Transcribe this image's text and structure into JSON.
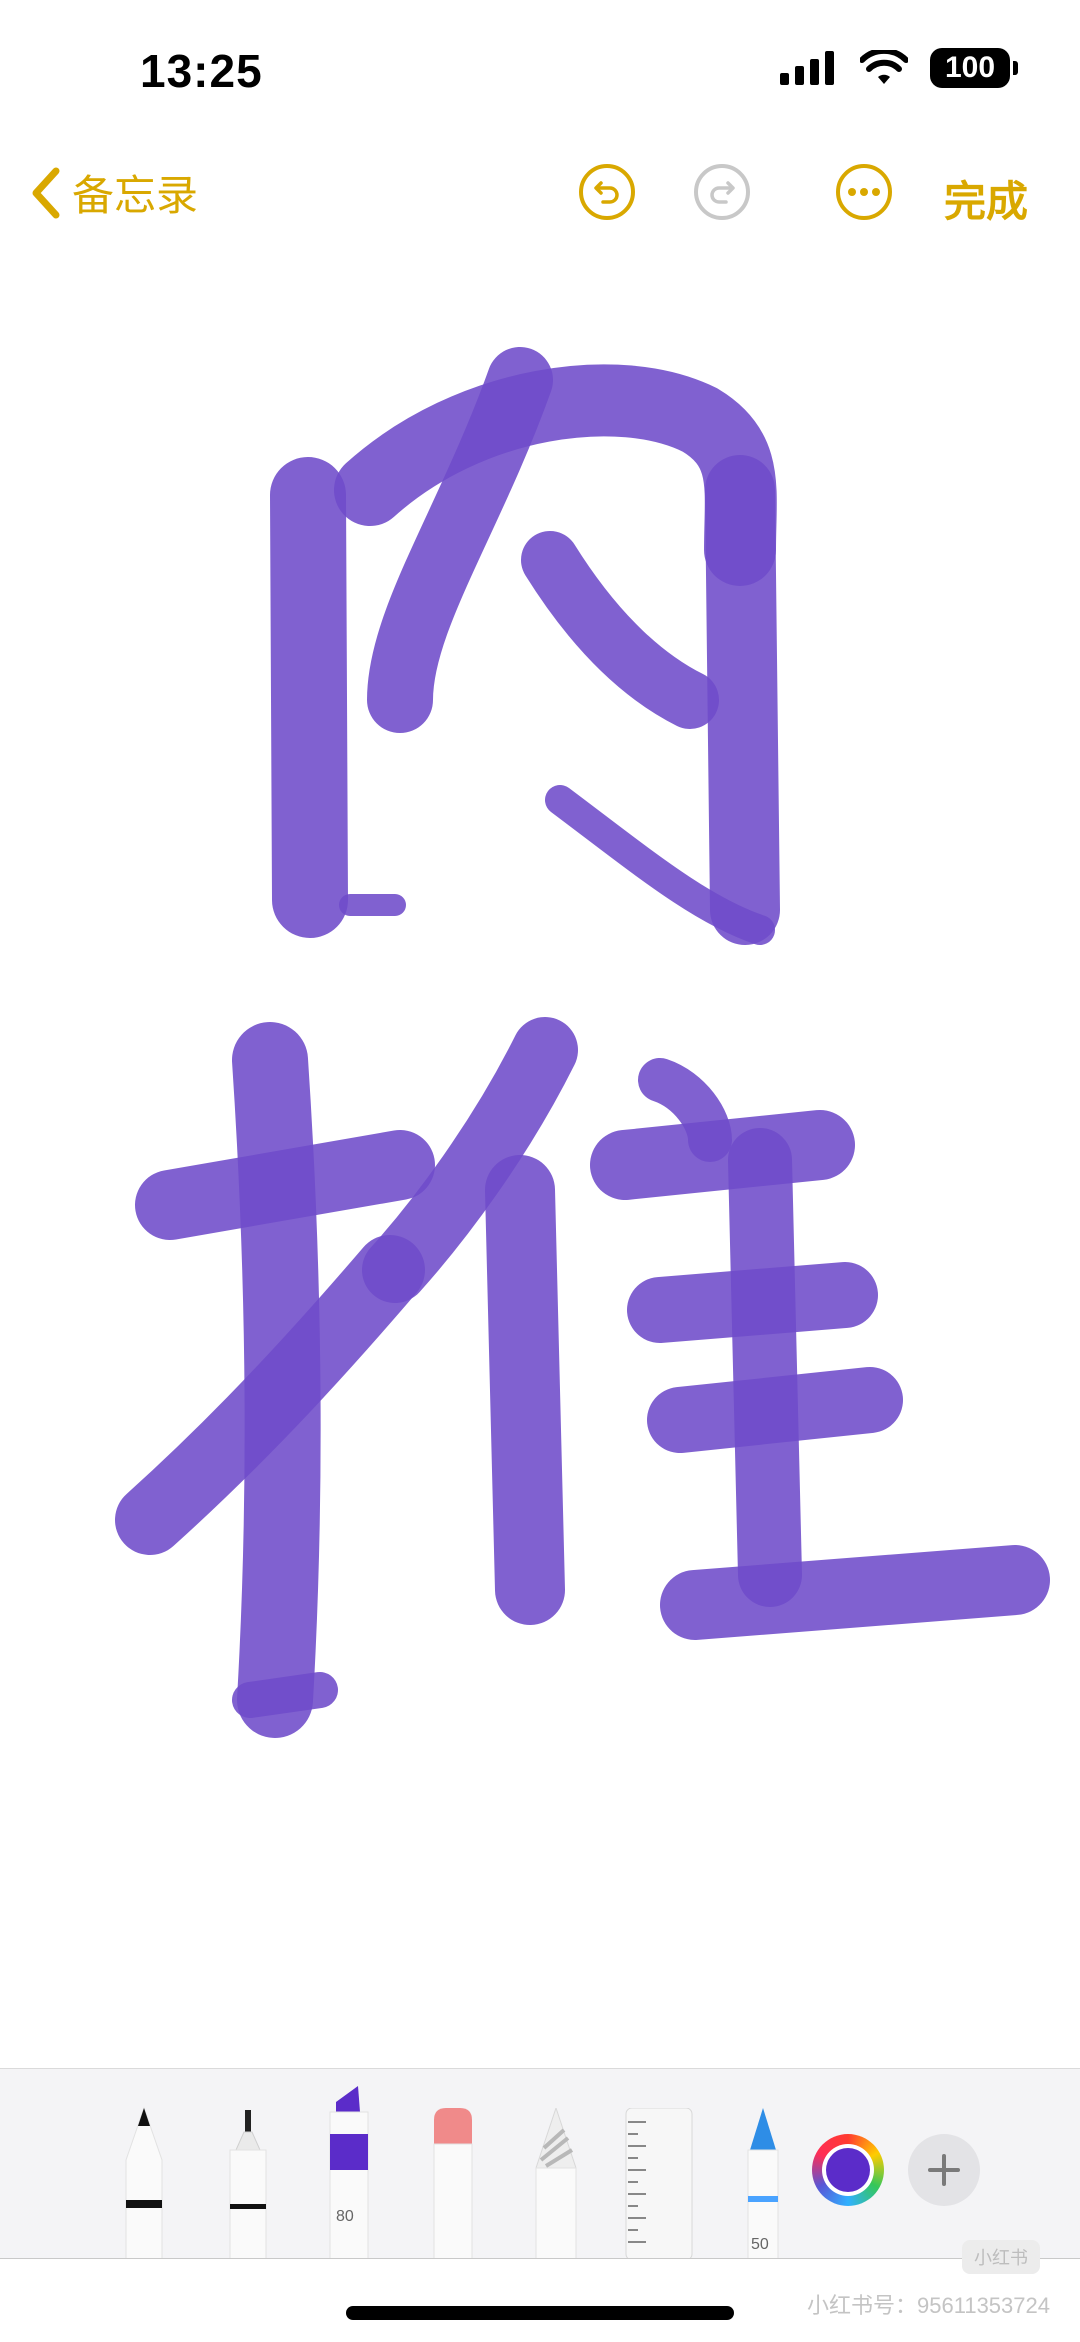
{
  "status_bar": {
    "time": "13:25",
    "battery": "100"
  },
  "nav": {
    "back_label": "备忘录",
    "done_label": "完成"
  },
  "drawing": {
    "characters": [
      "内",
      "推"
    ],
    "ink_color": "#6E4BC9"
  },
  "palette": {
    "marker_width": "80",
    "crayon_width": "50",
    "selected_color": "#5B2CC9"
  },
  "watermark": {
    "badge": "小红书",
    "text": "小红书号：95611353724"
  },
  "colors": {
    "accent": "#D9A800",
    "ink": "#6E4BC9"
  }
}
